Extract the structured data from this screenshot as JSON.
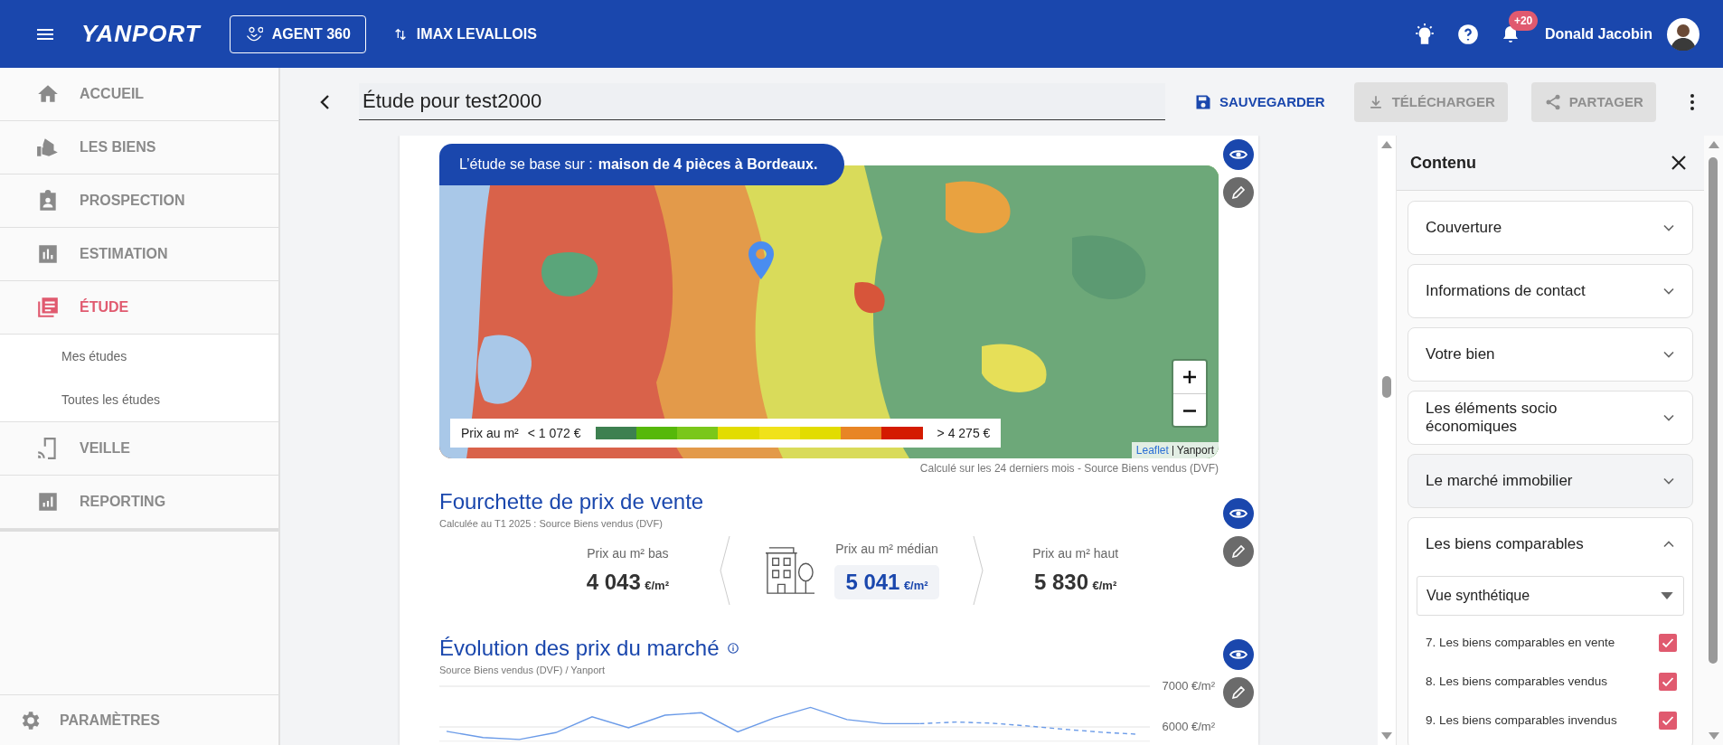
{
  "topbar": {
    "logo": "YANPORT",
    "agent_button": "AGENT 360",
    "agency": "IMAX LEVALLOIS",
    "notification_count": "+20",
    "user_name": "Donald Jacobin"
  },
  "sidebar": {
    "items": [
      {
        "label": "ACCUEIL",
        "selected": false
      },
      {
        "label": "LES BIENS",
        "selected": false
      },
      {
        "label": "PROSPECTION",
        "selected": false
      },
      {
        "label": "ESTIMATION",
        "selected": false
      },
      {
        "label": "ÉTUDE",
        "selected": true,
        "children": [
          {
            "label": "Mes études",
            "selected": false
          },
          {
            "label": "Toutes les études",
            "selected": false
          }
        ]
      },
      {
        "label": "VEILLE",
        "selected": false
      },
      {
        "label": "REPORTING",
        "selected": false
      }
    ],
    "footer": "PARAMÈTRES"
  },
  "header": {
    "title": "Étude pour test2000",
    "buttons": [
      {
        "label": "SAUVEGARDER",
        "disabled": false
      },
      {
        "label": "TÉLÉCHARGER",
        "disabled": true
      },
      {
        "label": "PARTAGER",
        "disabled": true
      }
    ]
  },
  "study_map": {
    "banner_prefix": "L’étude se base sur :",
    "banner_subject": "maison de 4 pièces à Bordeaux.",
    "legend": {
      "label": "Prix au m²",
      "min": "< 1 072 €",
      "max": "> 4 275 €",
      "segments": [
        {
          "color": "#3d8050"
        },
        {
          "color": "#56b80a"
        },
        {
          "color": "#7ac71a"
        },
        {
          "color": "#e2dc00"
        },
        {
          "color": "#f0e21a"
        },
        {
          "color": "#e2dc00"
        },
        {
          "color": "#e88525"
        },
        {
          "color": "#d41b00"
        }
      ]
    },
    "attribution_link": "Leaflet",
    "attribution_source": "Yanport",
    "caption": "Calculé sur les 24 derniers mois - Source Biens vendus (DVF)"
  },
  "price_range": {
    "title": "Fourchette de prix de vente",
    "subtitle": "Calculée au T1 2025 : Source Biens vendus (DVF)",
    "prices": [
      {
        "kind": "low",
        "label": "Prix au m² bas",
        "value": "4 043",
        "unit": "€/m²"
      },
      {
        "kind": "median",
        "label": "Prix au m² médian",
        "value": "5 041",
        "unit": "€/m²"
      },
      {
        "kind": "high",
        "label": "Prix au m² haut",
        "value": "5 830",
        "unit": "€/m²"
      }
    ]
  },
  "market_evolution": {
    "title": "Évolution des prix du marché",
    "subtitle": "Source Biens vendus (DVF) / Yanport",
    "chart_data": {
      "type": "line",
      "ylim": [
        5650,
        7000
      ],
      "yticks": [
        {
          "value": 6000,
          "label": "6000 €/m²"
        },
        {
          "value": 7000,
          "label": "7000 €/m²"
        }
      ],
      "series": [
        {
          "color": "#6b9be8",
          "line_style": "solid",
          "values": [
            5890,
            5740,
            5690,
            5860,
            6250,
            5980,
            6290,
            6350,
            5880,
            6220,
            6480,
            6180,
            6080,
            6080,
            null,
            null,
            null,
            null,
            null,
            null
          ]
        },
        {
          "color": "#6b9be8",
          "line_style": "dashed",
          "values": [
            null,
            null,
            null,
            null,
            null,
            null,
            null,
            null,
            null,
            null,
            null,
            null,
            null,
            6080,
            6120,
            6090,
            6020,
            5940,
            5870,
            5820
          ]
        }
      ]
    }
  },
  "content_panel": {
    "title": "Contenu",
    "sections": [
      {
        "label": "Couverture",
        "expanded": false,
        "selected": false
      },
      {
        "label": "Informations de contact",
        "expanded": false,
        "selected": false
      },
      {
        "label": "Votre bien",
        "expanded": false,
        "selected": false
      },
      {
        "label": "Les éléments socio économiques",
        "expanded": false,
        "selected": false
      },
      {
        "label": "Le marché immobilier",
        "expanded": false,
        "selected": true
      },
      {
        "label": "Les biens comparables",
        "expanded": true,
        "selected": false,
        "view": "Vue synthétique",
        "options": [
          {
            "label": "7. Les biens comparables en vente",
            "checked": true
          },
          {
            "label": "8. Les biens comparables vendus",
            "checked": true
          },
          {
            "label": "9. Les biens comparables invendus",
            "checked": true
          }
        ]
      }
    ]
  }
}
